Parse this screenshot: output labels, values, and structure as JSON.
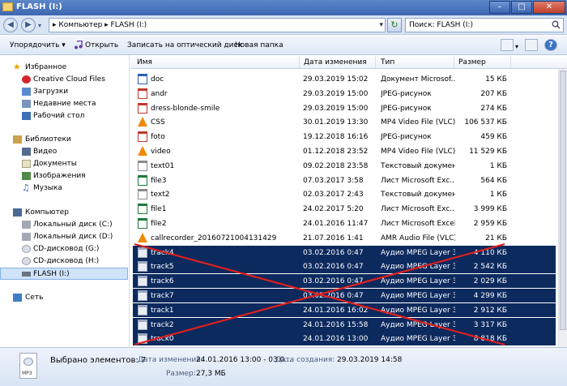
{
  "window": {
    "title": "FLASH (I:)"
  },
  "address": {
    "path": "▸ Компьютер ▸ FLASH (I:)",
    "search_placeholder": "Поиск: FLASH (I:)"
  },
  "toolbar": {
    "organize": "Упорядочить ▾",
    "open": "Открыть",
    "burn": "Записать на оптический диск",
    "new_folder": "Новая папка"
  },
  "sidebar": {
    "favorites": "Избранное",
    "creative_cloud": "Creative Cloud Files",
    "downloads": "Загрузки",
    "recent": "Недавние места",
    "desktop": "Рабочий стол",
    "libraries": "Библиотеки",
    "video": "Видео",
    "documents": "Документы",
    "images": "Изображения",
    "music": "Музыка",
    "computer": "Компьютер",
    "disk_c": "Локальный диск (C:)",
    "disk_d": "Локальный диск (D:)",
    "cd_g": "CD-дисковод (G:)",
    "cd_h": "CD-дисковод (H:)",
    "flash": "FLASH (I:)",
    "network": "Сеть"
  },
  "columns": {
    "name": "Имя",
    "date": "Дата изменения",
    "type": "Тип",
    "size": "Размер"
  },
  "files": [
    {
      "name": "doc",
      "date": "29.03.2019 15:02",
      "type": "Документ Microsof...",
      "size": "15 КБ",
      "icon": "word-doc-icon",
      "color": "#2b5fb4"
    },
    {
      "name": "andr",
      "date": "29.03.2019 15:00",
      "type": "JPEG-рисунок",
      "size": "207 КБ",
      "icon": "jpeg-icon",
      "color": "#c0392b"
    },
    {
      "name": "dress-blonde-smile",
      "date": "29.03.2019 15:00",
      "type": "JPEG-рисунок",
      "size": "274 КБ",
      "icon": "jpeg-icon",
      "color": "#c0392b"
    },
    {
      "name": "CSS",
      "date": "30.01.2019 13:30",
      "type": "MP4 Video File (VLC)",
      "size": "106 537 КБ",
      "icon": "vlc-icon",
      "color": "#f08a00"
    },
    {
      "name": "foto",
      "date": "19.12.2018 16:16",
      "type": "JPEG-рисунок",
      "size": "459 КБ",
      "icon": "jpeg-icon",
      "color": "#c0392b"
    },
    {
      "name": "video",
      "date": "01.12.2018 23:52",
      "type": "MP4 Video File (VLC)",
      "size": "11 529 КБ",
      "icon": "vlc-icon",
      "color": "#f08a00"
    },
    {
      "name": "text01",
      "date": "09.02.2018 23:58",
      "type": "Текстовый документ",
      "size": "1 КБ",
      "icon": "text-file-icon",
      "color": "#8a8a8a"
    },
    {
      "name": "file3",
      "date": "07.03.2017 3:58",
      "type": "Лист Microsoft Exc...",
      "size": "564 КБ",
      "icon": "excel-icon",
      "color": "#1e7b3a"
    },
    {
      "name": "text2",
      "date": "02.03.2017 2:43",
      "type": "Текстовый документ",
      "size": "1 КБ",
      "icon": "text-file-icon",
      "color": "#8a8a8a"
    },
    {
      "name": "file1",
      "date": "24.02.2017 5:20",
      "type": "Лист Microsoft Exc...",
      "size": "3 999 КБ",
      "icon": "excel-icon",
      "color": "#1e7b3a"
    },
    {
      "name": "file2",
      "date": "24.01.2016 11:47",
      "type": "Лист Microsoft Excel",
      "size": "2 959 КБ",
      "icon": "excel-icon",
      "color": "#1e7b3a"
    },
    {
      "name": "callrecorder_20160721004131429",
      "date": "21.07.2016 1:41",
      "type": "AMR Audio File (VLC)",
      "size": "21 КБ",
      "icon": "vlc-icon",
      "color": "#f08a00"
    },
    {
      "name": "track4",
      "date": "03.02.2016 0:47",
      "type": "Аудио MPEG Layer 3",
      "size": "4 110 КБ",
      "icon": "mp3-icon",
      "color": "#9aa8be",
      "selected": true
    },
    {
      "name": "track5",
      "date": "03.02.2016 0:47",
      "type": "Аудио MPEG Layer 3",
      "size": "2 542 КБ",
      "icon": "mp3-icon",
      "color": "#9aa8be",
      "selected": true
    },
    {
      "name": "track6",
      "date": "03.02.2016 0:47",
      "type": "Аудио MPEG Layer 3",
      "size": "2 029 КБ",
      "icon": "mp3-icon",
      "color": "#9aa8be",
      "selected": true
    },
    {
      "name": "track7",
      "date": "03.02.2016 0:47",
      "type": "Аудио MPEG Layer 3",
      "size": "4 299 КБ",
      "icon": "mp3-icon",
      "color": "#9aa8be",
      "selected": true
    },
    {
      "name": "track1",
      "date": "24.01.2016 16:02",
      "type": "Аудио MPEG Layer 3",
      "size": "2 912 КБ",
      "icon": "mp3-icon",
      "color": "#9aa8be",
      "selected": true
    },
    {
      "name": "track2",
      "date": "24.01.2016 15:58",
      "type": "Аудио MPEG Layer 3",
      "size": "3 317 КБ",
      "icon": "mp3-icon",
      "color": "#9aa8be",
      "selected": true
    },
    {
      "name": "track0",
      "date": "24.01.2016 13:00",
      "type": "Аудио MPEG Layer 3",
      "size": "8 818 КБ",
      "icon": "mp3-icon",
      "color": "#9aa8be",
      "selected": true
    }
  ],
  "status": {
    "selected_label": "Выбрано элементов: 7",
    "modified_label": "Дата изменения:",
    "modified_value": "24.01.2016 13:00 - 03.0...",
    "created_label": "Дата создания:",
    "created_value": "29.03.2019 14:58",
    "size_label": "Размер:",
    "size_value": "27,3 МБ",
    "icon_text": "MP3"
  },
  "colors": {
    "selection": "#0c2a5e",
    "cross": "#e0201c"
  }
}
